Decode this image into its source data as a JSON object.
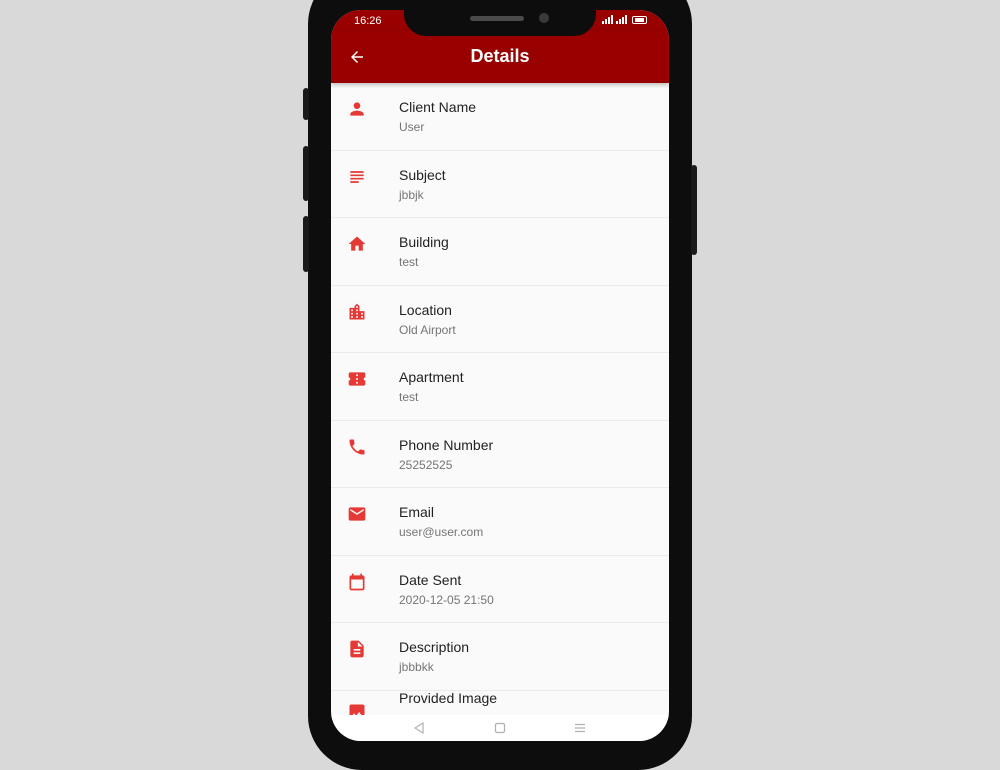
{
  "status_bar": {
    "time": "16:26"
  },
  "app_bar": {
    "title": "Details",
    "back_icon": "arrow-back-icon"
  },
  "colors": {
    "app_bar": "#990000",
    "accent_icon": "#e53935",
    "background": "#fafafa"
  },
  "items": [
    {
      "icon": "person-icon",
      "label": "Client Name",
      "value": "User"
    },
    {
      "icon": "subject-icon",
      "label": "Subject",
      "value": "jbbjk"
    },
    {
      "icon": "home-icon",
      "label": "Building",
      "value": "test"
    },
    {
      "icon": "location-city-icon",
      "label": "Location",
      "value": "Old Airport"
    },
    {
      "icon": "ticket-icon",
      "label": "Apartment",
      "value": "test"
    },
    {
      "icon": "phone-icon",
      "label": "Phone Number",
      "value": "25252525"
    },
    {
      "icon": "email-icon",
      "label": "Email",
      "value": "user@user.com"
    },
    {
      "icon": "calendar-icon",
      "label": "Date Sent",
      "value": "2020-12-05 21:50"
    },
    {
      "icon": "description-icon",
      "label": "Description",
      "value": "jbbbkk"
    },
    {
      "icon": "image-icon",
      "label": "Provided Image",
      "value": ""
    }
  ],
  "nav_bar": {
    "back": "back-triangle-icon",
    "home": "home-square-icon",
    "menu": "menu-lines-icon"
  }
}
